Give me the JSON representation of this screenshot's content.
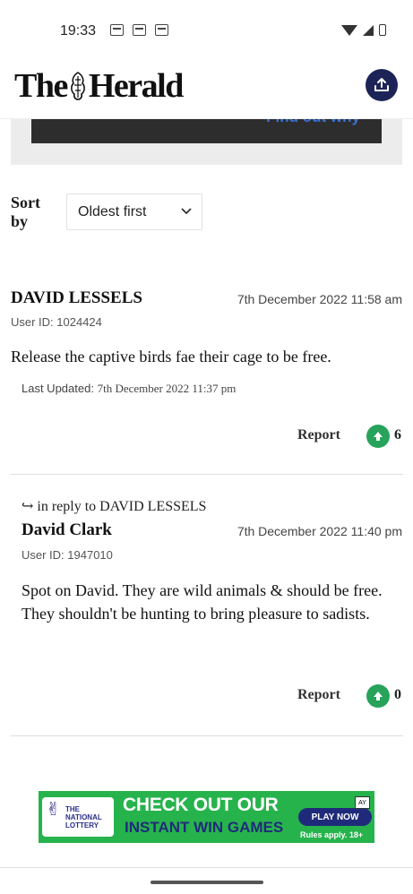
{
  "status_bar": {
    "time": "19:33"
  },
  "header": {
    "logo_left": "The",
    "logo_right": "Herald"
  },
  "promo": {
    "text": "Find out why"
  },
  "sort": {
    "label": "Sort by",
    "selected": "Oldest first"
  },
  "comments": [
    {
      "name": "DAVID LESSELS",
      "date": "7th December 2022 11:58 am",
      "user_id": "User ID: 1024424",
      "body": "Release the captive birds fae their cage to be free.",
      "updated_label": "Last Updated:",
      "updated_value": "7th December 2022 11:37 pm",
      "report": "Report",
      "votes": "6"
    },
    {
      "reply_to": "in reply to DAVID LESSELS",
      "name": "David Clark",
      "date": "7th December 2022 11:40 pm",
      "user_id": "User ID: 1947010",
      "body": "Spot on David. They are wild animals & should be free. They shouldn't be hunting to bring pleasure to sadists.",
      "report": "Report",
      "votes": "0"
    }
  ],
  "ad": {
    "brand_line1": "THE",
    "brand_line2": "NATIONAL",
    "brand_line3": "LOTTERY",
    "headline1": "CHECK OUT OUR",
    "headline2": "INSTANT WIN GAMES",
    "cta": "PLAY NOW",
    "rules": "Rules apply. 18+",
    "badge": "AY"
  }
}
